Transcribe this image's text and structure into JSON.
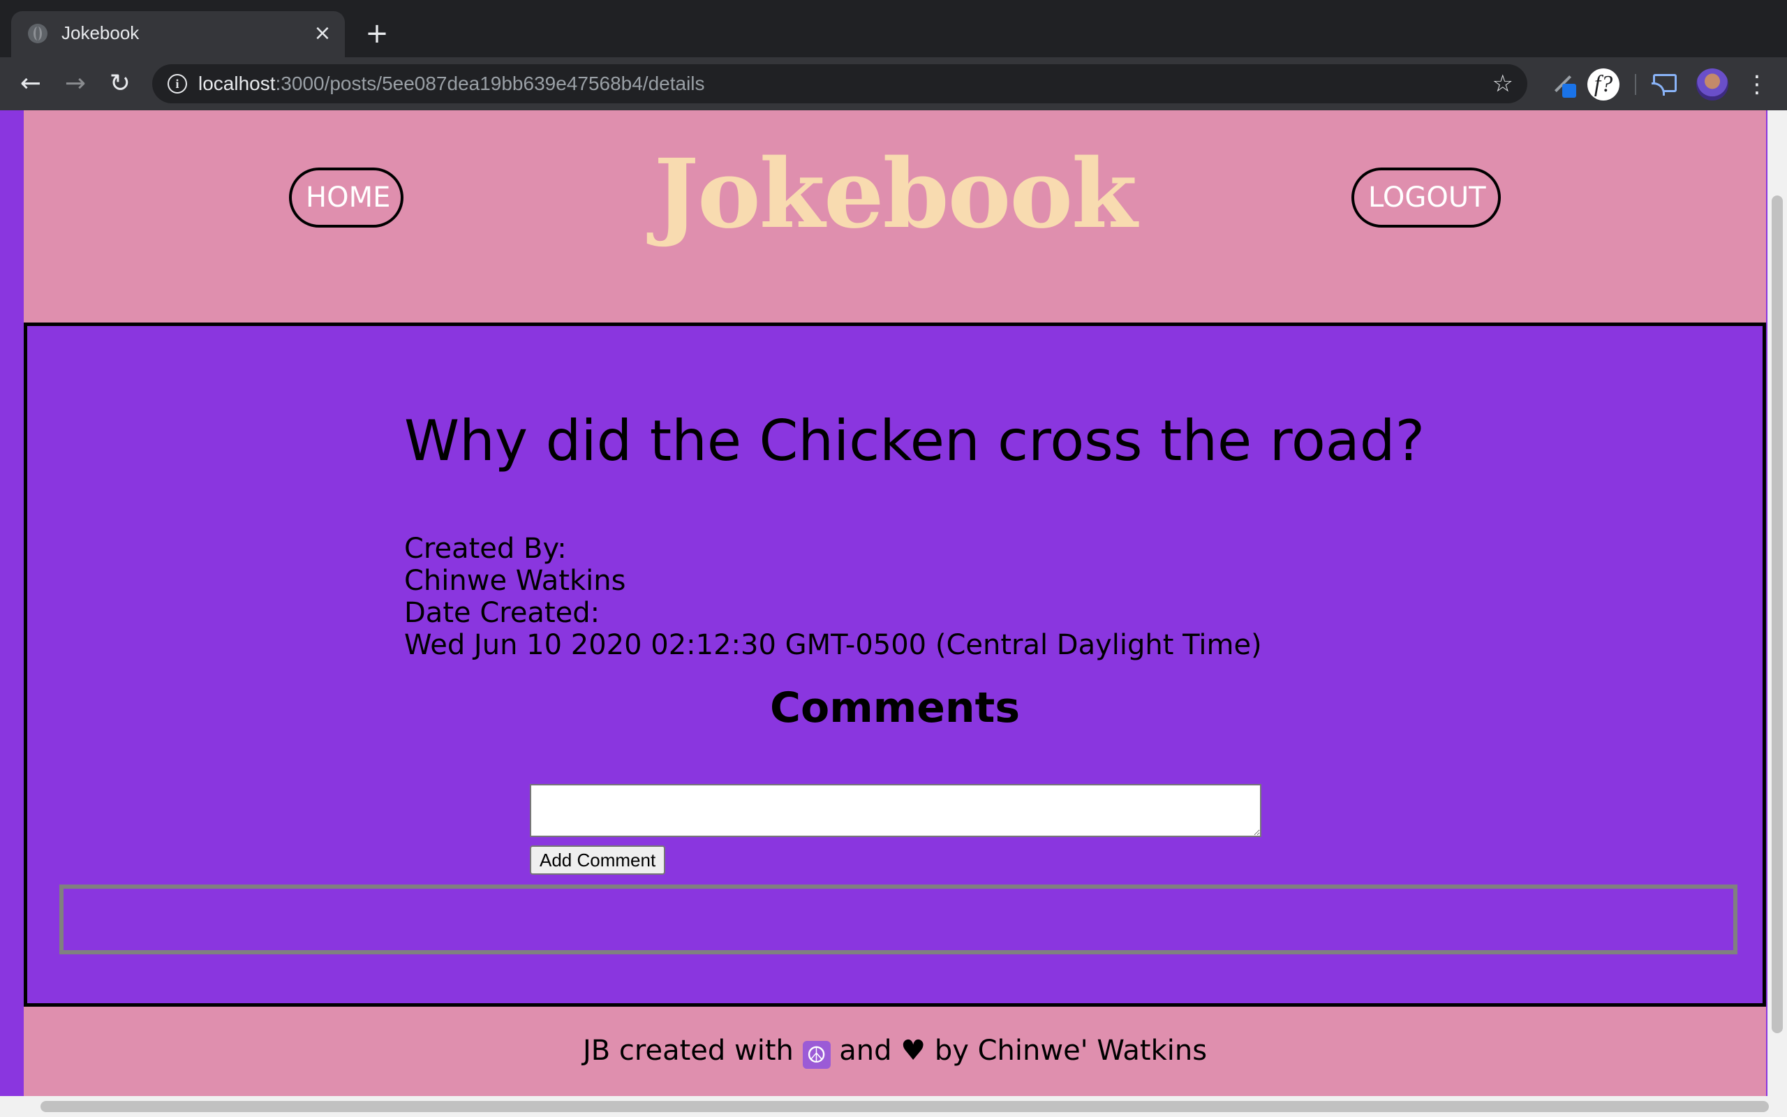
{
  "browser": {
    "tab_title": "Jokebook",
    "tab_close": "×",
    "new_tab": "+",
    "url_host": "localhost",
    "url_path": ":3000/posts/5ee087dea19bb639e47568b4/details",
    "back": "←",
    "forward": "→",
    "reload": "↻",
    "star": "☆",
    "ext_f": "f?",
    "menu": "⋮"
  },
  "header": {
    "home_label": "HOME",
    "brand": "Jokebook",
    "logout_label": "LOGOUT"
  },
  "post": {
    "title": "Why did the Chicken cross the road?",
    "created_by_label": "Created By:",
    "author": "Chinwe Watkins",
    "date_label": "Date Created:",
    "date_value": "Wed Jun 10 2020 02:12:30 GMT-0500 (Central Daylight Time)"
  },
  "comments": {
    "heading": "Comments",
    "input_value": "",
    "add_button": "Add Comment",
    "items": []
  },
  "footer": {
    "text_before": "JB created with ",
    "peace_symbol": "☮",
    "text_middle": " and ",
    "heart": "♥",
    "text_after": " by Chinwe' Watkins"
  },
  "colors": {
    "page_background": "#8a36df",
    "header_background": "#df8fae",
    "brand_color": "#f8dbb0"
  }
}
